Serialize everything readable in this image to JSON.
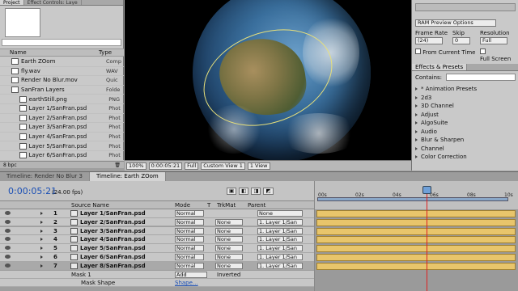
{
  "project": {
    "tabs": [
      "Project",
      "Effect Controls: Laye"
    ],
    "columns": {
      "name": "Name",
      "type": "Type"
    },
    "items": [
      {
        "name": "Earth ZOom",
        "type": "Comp",
        "child": false
      },
      {
        "name": "fly.wav",
        "type": "WAV",
        "child": false
      },
      {
        "name": "Render No Blur.mov",
        "type": "Quic",
        "child": false
      },
      {
        "name": "SanFran Layers",
        "type": "Folde",
        "child": false
      },
      {
        "name": "earthStill.png",
        "type": "PNG",
        "child": true
      },
      {
        "name": "Layer 1/SanFran.psd",
        "type": "Phot",
        "child": true
      },
      {
        "name": "Layer 2/SanFran.psd",
        "type": "Phot",
        "child": true
      },
      {
        "name": "Layer 3/SanFran.psd",
        "type": "Phot",
        "child": true
      },
      {
        "name": "Layer 4/SanFran.psd",
        "type": "Phot",
        "child": true
      },
      {
        "name": "Layer 5/SanFran.psd",
        "type": "Phot",
        "child": true
      },
      {
        "name": "Layer 6/SanFran.psd",
        "type": "Phot",
        "child": true
      }
    ],
    "bpc": "8 bpc"
  },
  "comp_bar": {
    "zoom": "100%",
    "time": "0:00:05:21",
    "resolution": "Full",
    "view": "Custom View 1",
    "views": "1 View"
  },
  "preview": {
    "ram_preview": "RAM Preview Options",
    "frame_rate_label": "Frame Rate",
    "frame_rate": "(24)",
    "skip_label": "Skip",
    "skip": "0",
    "resolution_label": "Resolution",
    "resolution": "Full",
    "from_current": "From Current Time",
    "full_screen": "Full Screen"
  },
  "effects": {
    "title": "Effects & Presets",
    "contains_label": "Contains:",
    "items": [
      "* Animation Presets",
      "2d3",
      "3D Channel",
      "Adjust",
      "AlgoSuite",
      "Audio",
      "Blur & Sharpen",
      "Channel",
      "Color Correction"
    ]
  },
  "timeline": {
    "tabs": [
      "Timeline: Render No Blur 3",
      "Timeline: Earth ZOom"
    ],
    "timecode": "0:00:05:21",
    "fps": "(24.00 fps)",
    "columns": {
      "source": "Source Name",
      "mode": "Mode",
      "t": "T",
      "trkmat": "TrkMat",
      "parent": "Parent"
    },
    "ruler": [
      "00s",
      "02s",
      "04s",
      "06s",
      "08s",
      "10s"
    ],
    "layers": [
      {
        "num": "1",
        "name": "Layer 1/SanFran.psd",
        "mode": "Normal",
        "trkmat": "",
        "parent": "None"
      },
      {
        "num": "2",
        "name": "Layer 2/SanFran.psd",
        "mode": "Normal",
        "trkmat": "None",
        "parent": "1. Layer 1/San"
      },
      {
        "num": "3",
        "name": "Layer 3/SanFran.psd",
        "mode": "Normal",
        "trkmat": "None",
        "parent": "1. Layer 1/San"
      },
      {
        "num": "4",
        "name": "Layer 4/SanFran.psd",
        "mode": "Normal",
        "trkmat": "None",
        "parent": "1. Layer 1/San"
      },
      {
        "num": "5",
        "name": "Layer 5/SanFran.psd",
        "mode": "Normal",
        "trkmat": "None",
        "parent": "1. Layer 1/San"
      },
      {
        "num": "6",
        "name": "Layer 6/SanFran.psd",
        "mode": "Normal",
        "trkmat": "None",
        "parent": "1. Layer 1/San"
      },
      {
        "num": "7",
        "name": "Layer 8/SanFran.psd",
        "mode": "Normal",
        "trkmat": "None",
        "parent": "1. Layer 1/San"
      }
    ],
    "masks": {
      "mask": "Mask 1",
      "mode": "Add",
      "inverted": "Inverted",
      "shape_label": "Mask Shape",
      "shape_value": "Shape..."
    }
  },
  "colors": {
    "accent": "#1a4fb5",
    "bar": "#e8c56b",
    "playhead": "#dd2222",
    "mask": "#e8e07a"
  }
}
